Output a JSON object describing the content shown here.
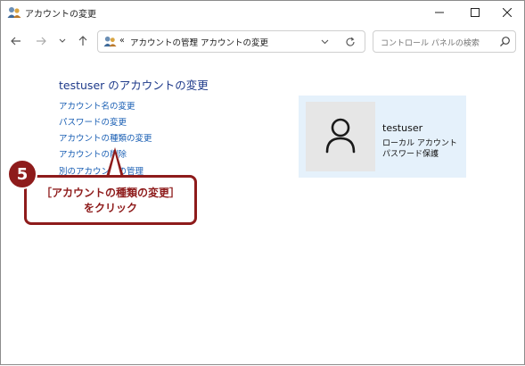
{
  "window": {
    "title": "アカウントの変更",
    "controls": [
      "minimize",
      "maximize",
      "close"
    ]
  },
  "address": {
    "overflow": "«",
    "crumbs": [
      "アカウントの管理",
      "アカウントの変更"
    ],
    "separator": "›"
  },
  "search": {
    "placeholder": "コントロール パネルの検索"
  },
  "main": {
    "heading": "testuser のアカウントの変更",
    "links": [
      "アカウント名の変更",
      "パスワードの変更",
      "アカウントの種類の変更",
      "アカウントの削除",
      "別のアカウントの管理"
    ]
  },
  "user": {
    "name": "testuser",
    "type": "ローカル アカウント",
    "protection": "パスワード保護"
  },
  "annotation": {
    "step": "5",
    "line1": "［アカウントの種類の変更］",
    "line2": "をクリック",
    "color": "#8e1b1b"
  }
}
